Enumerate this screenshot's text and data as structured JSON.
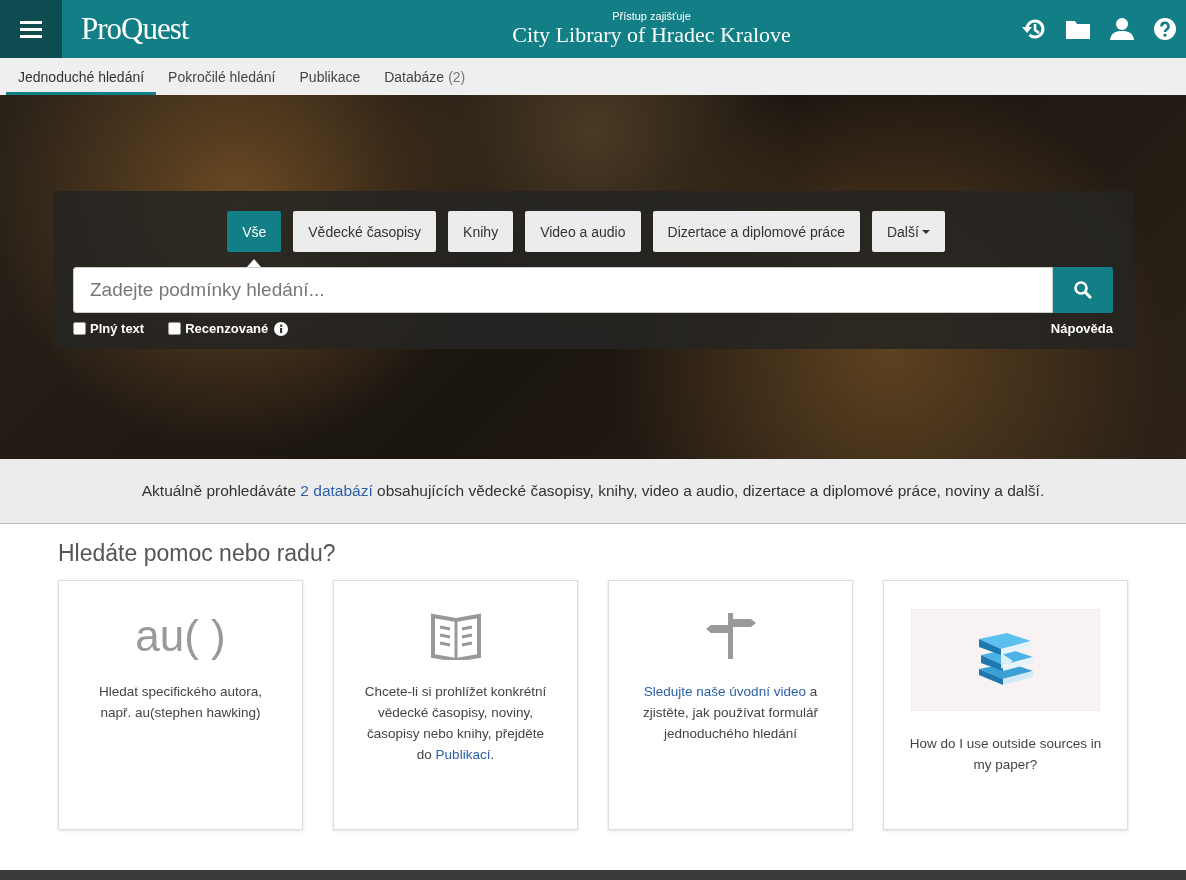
{
  "header": {
    "brand": "ProQuest",
    "access_label": "Přístup zajišťuje",
    "library": "City Library of Hradec Kralove"
  },
  "nav_tabs": [
    {
      "label": "Jednoduché hledání",
      "selected": true
    },
    {
      "label": "Pokročilé hledání",
      "selected": false
    },
    {
      "label": "Publikace",
      "selected": false
    },
    {
      "label": "Databáze",
      "count": "(2)",
      "selected": false
    }
  ],
  "search": {
    "source_tabs": [
      {
        "label": "Vše",
        "selected": true
      },
      {
        "label": "Vědecké časopisy",
        "selected": false
      },
      {
        "label": "Knihy",
        "selected": false
      },
      {
        "label": "Video a audio",
        "selected": false
      },
      {
        "label": "Dizertace a diplomové práce",
        "selected": false
      },
      {
        "label": "Další",
        "selected": false,
        "kind": "dropdown"
      }
    ],
    "placeholder": "Zadejte podmínky hledání...",
    "options": [
      {
        "label": "Plný text",
        "checked": false,
        "info": false
      },
      {
        "label": "Recenzované",
        "checked": false,
        "info": true
      }
    ],
    "help_link": "Nápověda"
  },
  "banner": {
    "parts": [
      {
        "text": "Aktuálně prohledáváte "
      },
      {
        "text": "2 databází",
        "link": true
      },
      {
        "text": " obsahujících vědecké časopisy, knihy, video a audio, dizertace a diplomové práce, noviny a další."
      }
    ]
  },
  "help": {
    "title": "Hledáte pomoc nebo radu?",
    "cards": [
      {
        "kind": "syntax",
        "graphic_text": "au( )",
        "parts": [
          {
            "text": "Hledat specifického autora, např. au(stephen hawking)"
          }
        ]
      },
      {
        "kind": "book",
        "parts": [
          {
            "text": "Chcete-li si prohlížet konkrétní vědecké časopisy, noviny, časopisy nebo knihy, přejděte do "
          },
          {
            "text": "Publikací",
            "link": true
          },
          {
            "text": "."
          }
        ]
      },
      {
        "kind": "signpost",
        "parts": [
          {
            "text": "Sledujte naše úvodní video",
            "link": true
          },
          {
            "text": " a zjistěte, jak používat formulář jednoduchého hledání"
          }
        ]
      },
      {
        "kind": "video",
        "parts": [
          {
            "text": "How do I use outside sources in my paper?"
          }
        ]
      }
    ]
  }
}
